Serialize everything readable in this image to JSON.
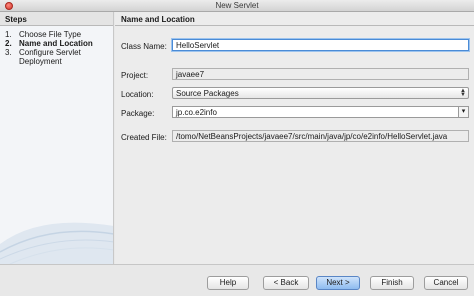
{
  "window": {
    "title": "New Servlet"
  },
  "steps": {
    "heading": "Steps",
    "items": [
      {
        "num": "1.",
        "label": "Choose File Type"
      },
      {
        "num": "2.",
        "label": "Name and Location"
      },
      {
        "num": "3.",
        "label": "Configure Servlet Deployment"
      }
    ]
  },
  "panel": {
    "heading": "Name and Location",
    "class_name_label": "Class Name:",
    "class_name_value": "HelloServlet",
    "project_label": "Project:",
    "project_value": "javaee7",
    "location_label": "Location:",
    "location_value": "Source Packages",
    "package_label": "Package:",
    "package_value": "jp.co.e2info",
    "created_file_label": "Created File:",
    "created_file_value": "/tomo/NetBeansProjects/javaee7/src/main/java/jp/co/e2info/HelloServlet.java"
  },
  "buttons": {
    "help": "Help",
    "back": "< Back",
    "next": "Next >",
    "finish": "Finish",
    "cancel": "Cancel"
  }
}
